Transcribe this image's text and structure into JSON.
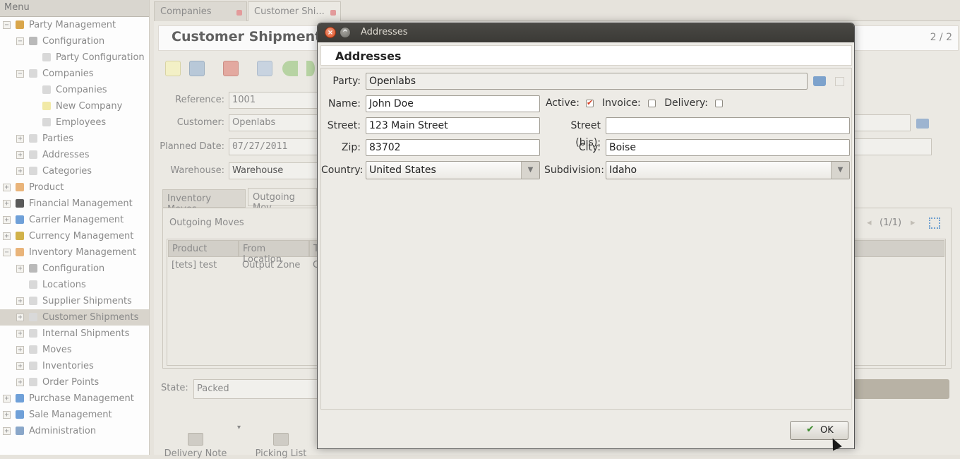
{
  "menu": {
    "header": "Menu",
    "items": [
      {
        "label": "Party Management",
        "expander": "−"
      },
      {
        "label": "Configuration",
        "expander": "−"
      },
      {
        "label": "Party Configuration",
        "expander": ""
      },
      {
        "label": "Companies",
        "expander": "−"
      },
      {
        "label": "Companies",
        "expander": ""
      },
      {
        "label": "New Company",
        "expander": ""
      },
      {
        "label": "Employees",
        "expander": ""
      },
      {
        "label": "Parties",
        "expander": "+"
      },
      {
        "label": "Addresses",
        "expander": "+"
      },
      {
        "label": "Categories",
        "expander": "+"
      },
      {
        "label": "Product",
        "expander": "+"
      },
      {
        "label": "Financial Management",
        "expander": "+"
      },
      {
        "label": "Carrier Management",
        "expander": "+"
      },
      {
        "label": "Currency Management",
        "expander": "+"
      },
      {
        "label": "Inventory Management",
        "expander": "−"
      },
      {
        "label": "Configuration",
        "expander": "+"
      },
      {
        "label": "Locations",
        "expander": ""
      },
      {
        "label": "Supplier Shipments",
        "expander": "+"
      },
      {
        "label": "Customer Shipments",
        "expander": "+"
      },
      {
        "label": "Internal Shipments",
        "expander": "+"
      },
      {
        "label": "Moves",
        "expander": "+"
      },
      {
        "label": "Inventories",
        "expander": "+"
      },
      {
        "label": "Order Points",
        "expander": "+"
      },
      {
        "label": "Purchase Management",
        "expander": "+"
      },
      {
        "label": "Sale Management",
        "expander": "+"
      },
      {
        "label": "Administration",
        "expander": "+"
      }
    ]
  },
  "tabs": [
    {
      "label": "Companies"
    },
    {
      "label": "Customer Shi..."
    }
  ],
  "form": {
    "title": "Customer Shipment",
    "record_counter": "2 / 2",
    "reference_label": "Reference:",
    "reference_value": "1001",
    "customer_label": "Customer:",
    "customer_value": "Openlabs",
    "planned_date_label": "Planned Date:",
    "planned_date_value": "07/27/2011",
    "warehouse_label": "Warehouse:",
    "warehouse_value": "Warehouse",
    "subtab_inventory": "Inventory Moves",
    "subtab_outgoing": "Outgoing Mov",
    "outgoing_title": "Outgoing Moves",
    "pager": "(1/1)",
    "columns": [
      "Product",
      "From Location",
      "T"
    ],
    "row": [
      "[tets] test",
      "Output Zone",
      "C"
    ],
    "state_label": "State:",
    "state_value": "Packed",
    "delivery_note": "Delivery Note",
    "picking_list": "Picking List",
    "dropdown_glyph": "▾"
  },
  "dialog": {
    "window_title": "Addresses",
    "header": "Addresses",
    "party_label": "Party:",
    "party_value": "Openlabs",
    "name_label": "Name:",
    "name_value": "John Doe",
    "active_label": "Active:",
    "invoice_label": "Invoice:",
    "delivery_label": "Delivery:",
    "street_label": "Street:",
    "street_value": "123 Main Street",
    "street_bis_label": "Street (bis):",
    "street_bis_value": "",
    "zip_label": "Zip:",
    "zip_value": "83702",
    "city_label": "City:",
    "city_value": "Boise",
    "country_label": "Country:",
    "country_value": "United States",
    "subdivision_label": "Subdivision:",
    "subdivision_value": "Idaho",
    "ok_label": "OK",
    "active": true,
    "invoice": false,
    "delivery": false
  },
  "colors": {
    "dialog_titlebar": "#3b3a36",
    "close_button": "#dc4b1c",
    "checkbox_check": "#d63b1f",
    "ok_check": "#3d8b2e"
  }
}
